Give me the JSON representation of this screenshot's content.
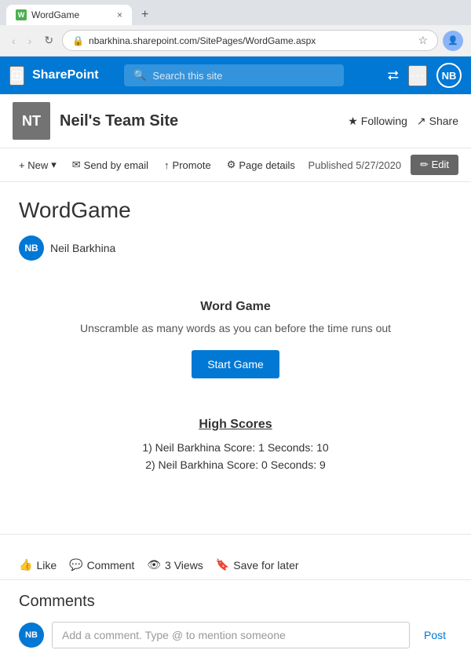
{
  "browser": {
    "tab": {
      "favicon_label": "W",
      "title": "WordGame",
      "close": "×",
      "new_tab": "+"
    },
    "nav": {
      "back": "‹",
      "forward": "›",
      "refresh": "↻",
      "address": "nbarkhina.sharepoint.com/SitePages/WordGame.aspx",
      "star": "☆"
    }
  },
  "topbar": {
    "waffle": "⊞",
    "app_name": "SharePoint",
    "search_placeholder": "Search this site",
    "avatar_initials": "NB"
  },
  "site_header": {
    "logo_initials": "NT",
    "site_name": "Neil's Team Site",
    "follow_label": "Following",
    "share_label": "Share"
  },
  "action_bar": {
    "new_label": "+ New",
    "send_email_label": "Send by email",
    "promote_label": "Promote",
    "page_details_label": "Page details",
    "published_label": "Published 5/27/2020",
    "edit_label": "✏ Edit"
  },
  "page": {
    "title": "WordGame",
    "author": "Neil Barkhina",
    "author_initials": "NB"
  },
  "game": {
    "title": "Word Game",
    "description": "Unscramble as many words as you can before the time runs out",
    "start_button": "Start Game",
    "high_scores_title": "High Scores",
    "scores": [
      {
        "rank": "1)",
        "name": "Neil Barkhina",
        "score": "Score: 1",
        "seconds": "Seconds: 10"
      },
      {
        "rank": "2)",
        "name": "Neil Barkhina",
        "score": "Score: 0",
        "seconds": "Seconds: 9"
      }
    ]
  },
  "footer": {
    "like_label": "Like",
    "comment_label": "Comment",
    "views_label": "3 Views",
    "save_label": "Save for later"
  },
  "comments": {
    "title": "Comments",
    "commenter_initials": "NB",
    "input_placeholder": "Add a comment. Type @ to mention someone",
    "post_label": "Post"
  }
}
